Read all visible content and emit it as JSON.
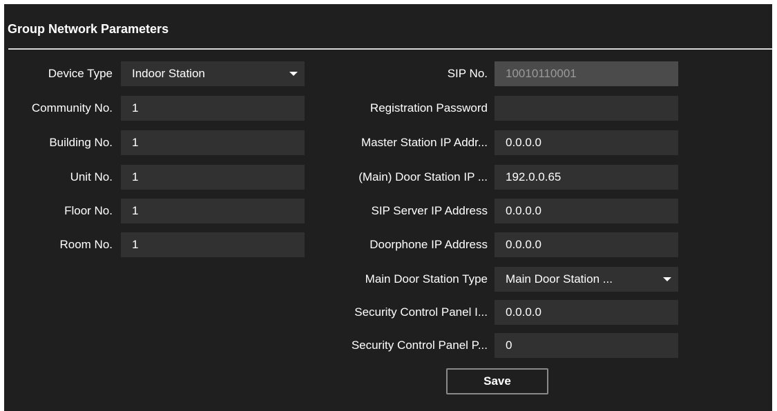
{
  "title": "Group Network Parameters",
  "left_fields": [
    {
      "label": "Device Type",
      "value": "Indoor Station",
      "type": "select"
    },
    {
      "label": "Community No.",
      "value": "1"
    },
    {
      "label": "Building No.",
      "value": "1"
    },
    {
      "label": "Unit No.",
      "value": "1"
    },
    {
      "label": "Floor No.",
      "value": "1"
    },
    {
      "label": "Room No.",
      "value": "1"
    }
  ],
  "right_fields": [
    {
      "label": "SIP No.",
      "value": "10010110001",
      "disabled": true
    },
    {
      "label": "Registration Password",
      "value": ""
    },
    {
      "label": "Master Station IP Addr...",
      "value": "0.0.0.0"
    },
    {
      "label": "(Main) Door Station IP ...",
      "value": "192.0.0.65"
    },
    {
      "label": "SIP Server IP Address",
      "value": "0.0.0.0"
    },
    {
      "label": "Doorphone IP Address",
      "value": "0.0.0.0"
    },
    {
      "label": "Main Door Station Type",
      "value": "Main Door Station ...",
      "type": "select"
    },
    {
      "label": "Security Control Panel I...",
      "value": "0.0.0.0"
    },
    {
      "label": "Security Control Panel P...",
      "value": "0"
    }
  ],
  "save_label": "Save",
  "icons": {
    "dropdown": "chevron-down-icon"
  },
  "colors": {
    "background": "#1f1f1f",
    "field": "#313131",
    "field_disabled": "#4b4b4b",
    "text": "#ffffff",
    "divider": "#d8d8d8"
  }
}
